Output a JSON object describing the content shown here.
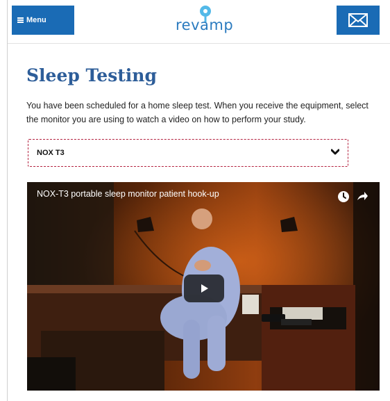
{
  "header": {
    "menu_label": "Menu",
    "logo_text": "revamp"
  },
  "page": {
    "title": "Sleep Testing",
    "intro": "You have been scheduled for a home sleep test. When you receive the equipment, select the monitor you are using to watch a video on how to perform your study."
  },
  "monitor_select": {
    "value": "NOX T3"
  },
  "video": {
    "title": "NOX-T3 portable sleep monitor patient hook-up"
  },
  "colors": {
    "brand_blue": "#1a6bb5",
    "title_blue": "#2d5d99",
    "select_border": "#b3203e"
  },
  "icons": {
    "menu": "hamburger-icon",
    "mail": "envelope-icon",
    "select": "chevron-down-icon",
    "watch_later": "clock-icon",
    "share": "share-icon",
    "play": "play-icon"
  }
}
